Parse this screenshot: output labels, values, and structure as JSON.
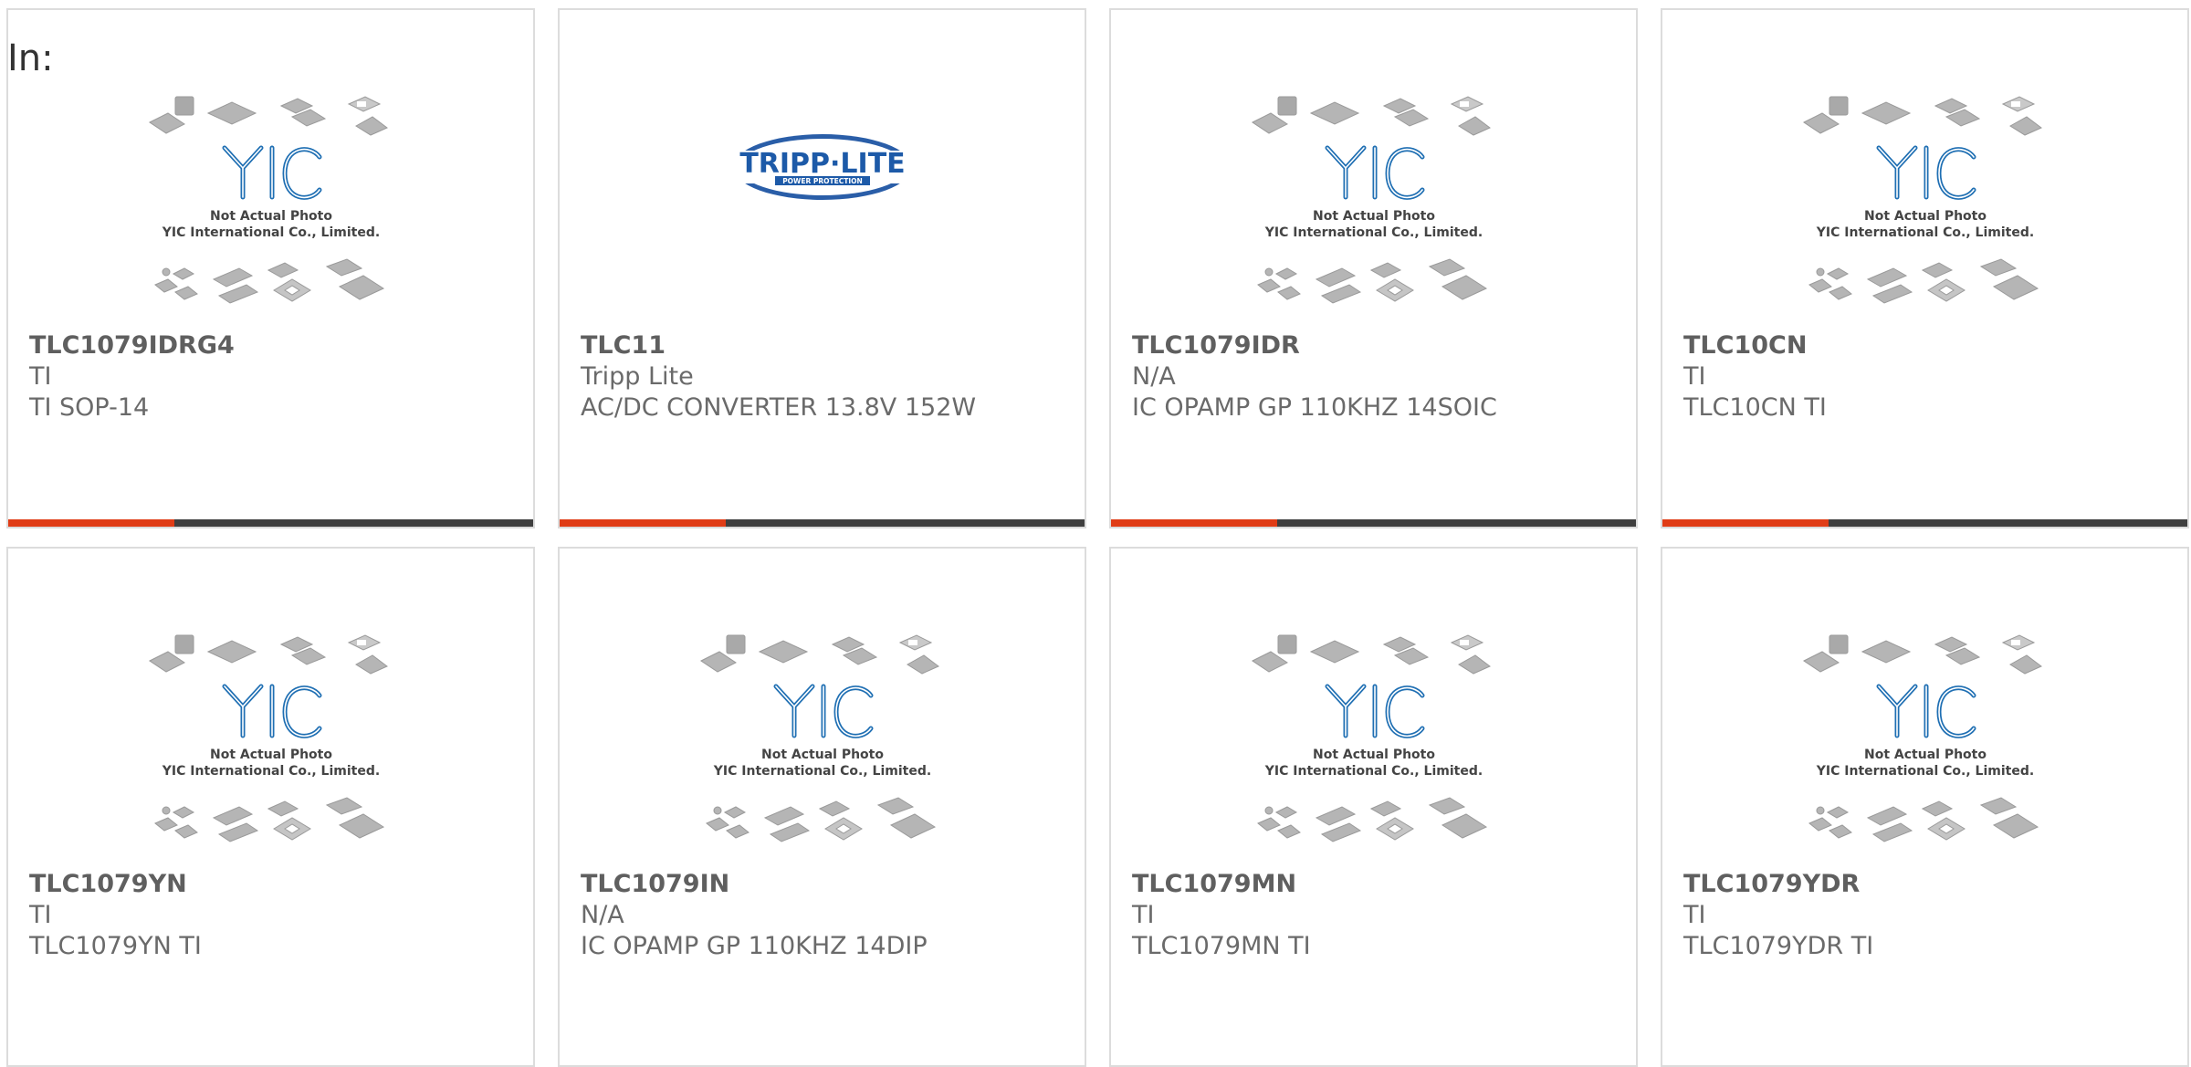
{
  "header": {
    "label": "In:"
  },
  "placeholder": {
    "line1": "Not Actual Photo",
    "line2": "YIC International Co., Limited.",
    "logo": "YIC"
  },
  "brand_logo": {
    "name": "TRIPP·LITE",
    "tagline": "POWER PROTECTION"
  },
  "colors": {
    "accent": "#e03c16",
    "bar": "#3f3f3f",
    "border": "#dcdcdc",
    "logo_blue": "#1f6fb3"
  },
  "products": [
    {
      "part": "TLC1079IDRG4",
      "manufacturer": "TI",
      "description": "TI SOP-14",
      "image": "yic-placeholder"
    },
    {
      "part": "TLC11",
      "manufacturer": "Tripp Lite",
      "description": "AC/DC CONVERTER 13.8V 152W",
      "image": "tripp-lite-logo"
    },
    {
      "part": "TLC1079IDR",
      "manufacturer": "N/A",
      "description": "IC OPAMP GP 110KHZ 14SOIC",
      "image": "yic-placeholder"
    },
    {
      "part": "TLC10CN",
      "manufacturer": "TI",
      "description": "TLC10CN TI",
      "image": "yic-placeholder"
    },
    {
      "part": "TLC1079YN",
      "manufacturer": "TI",
      "description": "TLC1079YN TI",
      "image": "yic-placeholder"
    },
    {
      "part": "TLC1079IN",
      "manufacturer": "N/A",
      "description": "IC OPAMP GP 110KHZ 14DIP",
      "image": "yic-placeholder"
    },
    {
      "part": "TLC1079MN",
      "manufacturer": "TI",
      "description": "TLC1079MN TI",
      "image": "yic-placeholder"
    },
    {
      "part": "TLC1079YDR",
      "manufacturer": "TI",
      "description": "TLC1079YDR TI",
      "image": "yic-placeholder"
    }
  ]
}
